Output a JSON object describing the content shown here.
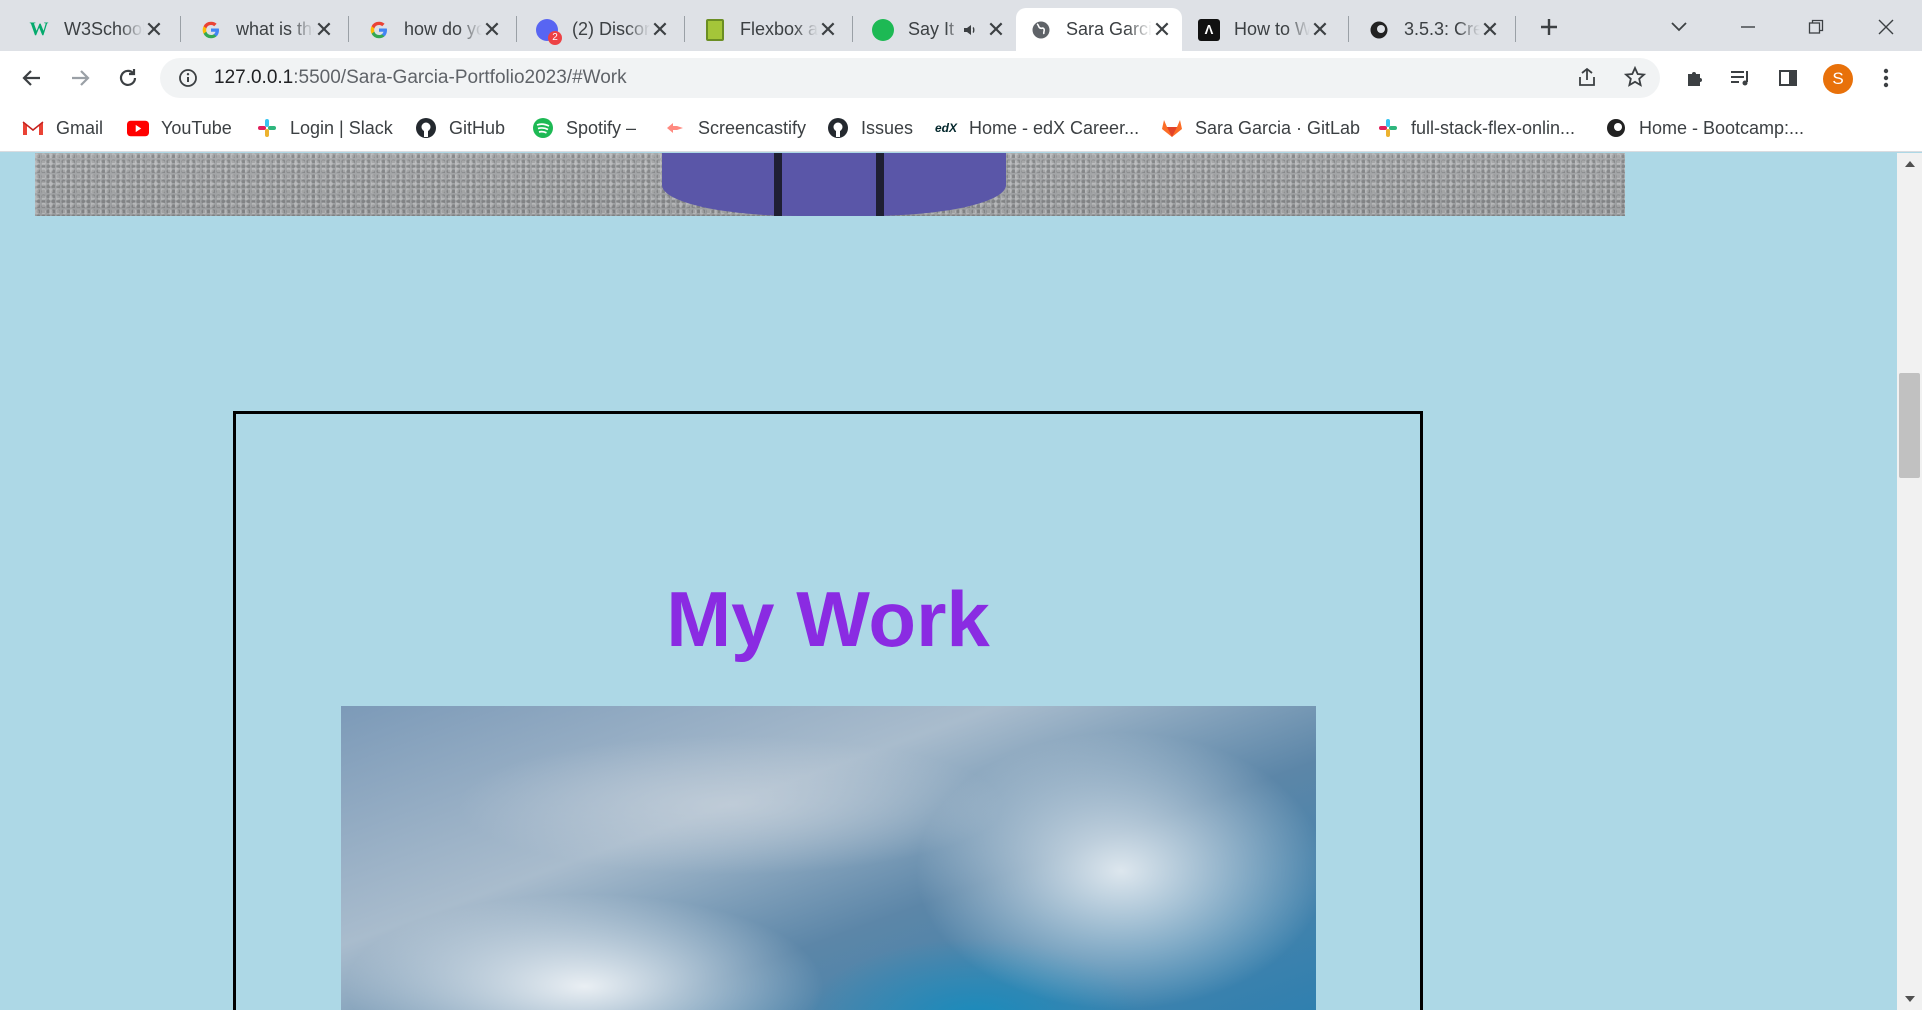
{
  "browser": {
    "tabs": [
      {
        "title": "W3Schools",
        "icon": "w3schools-icon"
      },
      {
        "title": "what is the",
        "icon": "google-icon"
      },
      {
        "title": "how do you",
        "icon": "google-icon"
      },
      {
        "title": "(2) Discord",
        "icon": "discord-icon",
        "badge": "2"
      },
      {
        "title": "Flexbox an",
        "icon": "sheets-icon"
      },
      {
        "title": "Say It",
        "icon": "spotify-icon",
        "audio": true
      },
      {
        "title": "Sara Garcia",
        "icon": "globe-icon",
        "active": true
      },
      {
        "title": "How to W",
        "icon": "webflow-icon"
      },
      {
        "title": "3.5.3: Cre",
        "icon": "bootcamp-icon"
      }
    ],
    "url": {
      "host": "127.0.0.1",
      "rest": ":5500/Sara-Garcia-Portfolio2023/#Work"
    },
    "profile_initial": "S",
    "bookmarks": [
      {
        "label": "Gmail",
        "icon": "gmail-icon"
      },
      {
        "label": "YouTube",
        "icon": "youtube-icon"
      },
      {
        "label": "Login | Slack",
        "icon": "slack-icon"
      },
      {
        "label": "GitHub",
        "icon": "github-icon"
      },
      {
        "label": "Spotify –",
        "icon": "spotify-icon"
      },
      {
        "label": "Screencastify",
        "icon": "screencastify-icon"
      },
      {
        "label": "Issues",
        "icon": "github-icon"
      },
      {
        "label": "Home - edX Career...",
        "icon": "edx-icon"
      },
      {
        "label": "Sara Garcia · GitLab",
        "icon": "gitlab-icon"
      },
      {
        "label": "full-stack-flex-onlin...",
        "icon": "slack-icon"
      },
      {
        "label": "Home - Bootcamp:...",
        "icon": "bootcamp-icon"
      }
    ]
  },
  "page": {
    "work_section": {
      "title": "My Work"
    },
    "scroll_position": 0.28
  },
  "colors": {
    "page_background": "#add8e6",
    "title_color": "#8a2be2",
    "profile_avatar": "#e8710a"
  }
}
